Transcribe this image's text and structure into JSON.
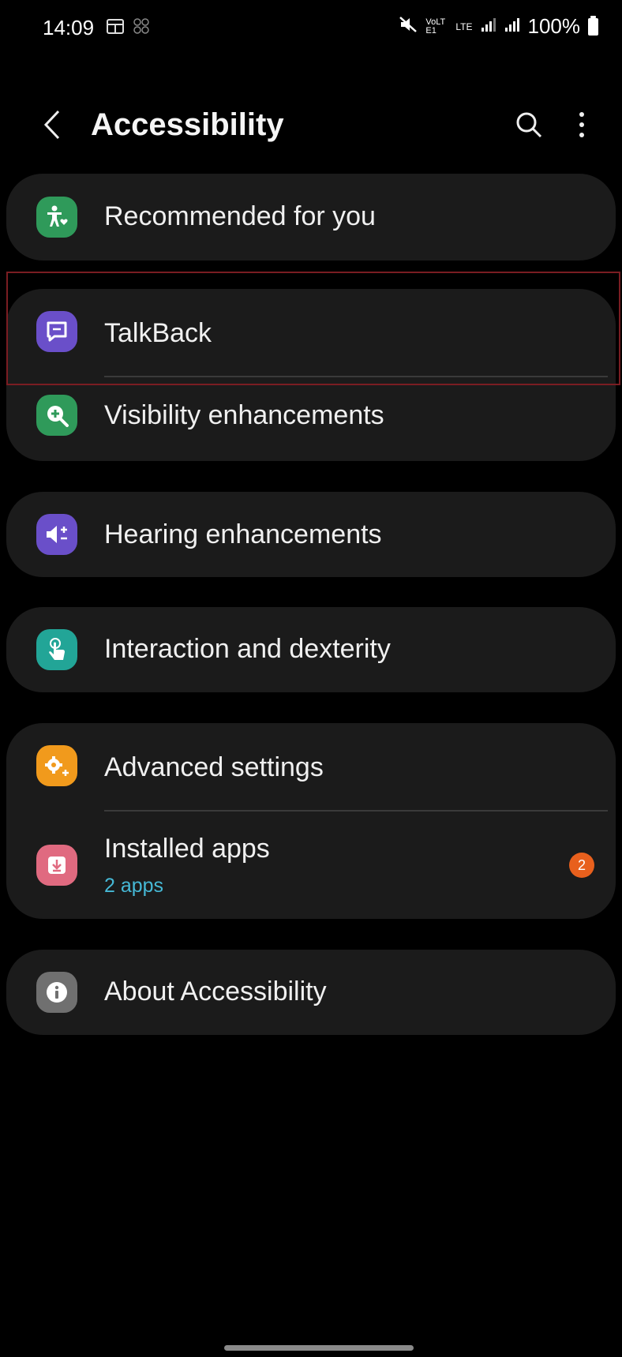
{
  "status_bar": {
    "time": "14:09",
    "left_icons": [
      "calendar-icon",
      "pinwheel-icon"
    ],
    "right_icons": [
      "mute-icon",
      "volte-icon",
      "lte-icon",
      "signal-icon",
      "signal-icon"
    ],
    "volte_text": "VoLTE1",
    "lte_text": "LTE",
    "battery_percent": "100%"
  },
  "app_bar": {
    "title": "Accessibility",
    "back_icon": "back-chevron-icon",
    "search_icon": "search-icon",
    "more_icon": "more-vert-icon"
  },
  "groups": [
    {
      "items": [
        {
          "label": "Recommended for you",
          "icon": "accessibility-person-icon",
          "icon_color": "#2f9a5a"
        }
      ]
    },
    {
      "items": [
        {
          "label": "TalkBack",
          "icon": "chat-bubble-icon",
          "icon_color": "#6a4fc9"
        },
        {
          "label": "Visibility enhancements",
          "icon": "zoom-in-icon",
          "icon_color": "#2f9a5a"
        }
      ]
    },
    {
      "items": [
        {
          "label": "Hearing enhancements",
          "icon": "speaker-icon",
          "icon_color": "#6a4fc9"
        }
      ]
    },
    {
      "items": [
        {
          "label": "Interaction and dexterity",
          "icon": "touch-hand-icon",
          "icon_color": "#22a597"
        }
      ]
    },
    {
      "items": [
        {
          "label": "Advanced settings",
          "icon": "gear-plus-icon",
          "icon_color": "#f19a1c"
        },
        {
          "label": "Installed apps",
          "subtitle": "2 apps",
          "badge": "2",
          "icon": "download-icon",
          "icon_color": "#e06a80"
        }
      ]
    },
    {
      "items": [
        {
          "label": "About Accessibility",
          "icon": "info-icon",
          "icon_color": "#707070"
        }
      ]
    }
  ],
  "colors": {
    "background": "#000000",
    "card": "#1b1b1b",
    "subtitle_accent": "#46b9d6",
    "badge": "#e8601d",
    "highlight_border": "#7a1d22"
  }
}
